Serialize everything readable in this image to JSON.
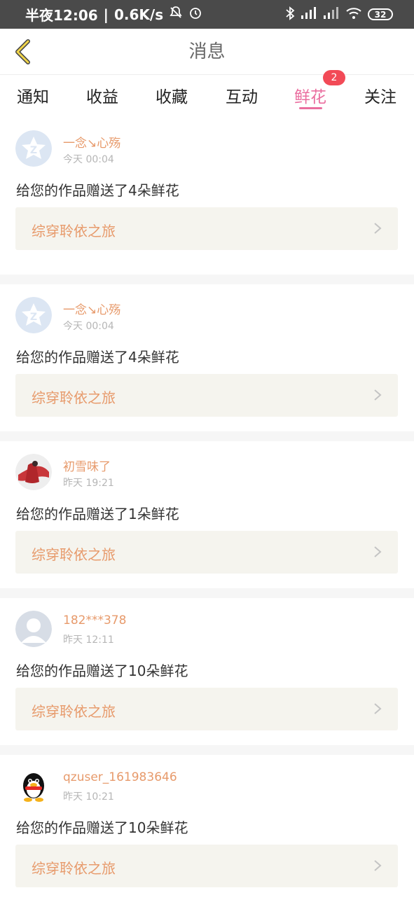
{
  "status_bar": {
    "time": "半夜12:06",
    "speed": "0.6K/s",
    "battery": "32"
  },
  "header": {
    "title": "消息"
  },
  "tabs": [
    {
      "label": "通知"
    },
    {
      "label": "收益"
    },
    {
      "label": "收藏"
    },
    {
      "label": "互动"
    },
    {
      "label": "鲜花",
      "active": true
    },
    {
      "label": "关注"
    }
  ],
  "badge_count": "2",
  "items": [
    {
      "name": "一念↘心殇",
      "time": "今天 00:04",
      "message": "给您的作品赠送了4朵鲜花",
      "book": "综穿聆依之旅",
      "avatar": "qzone-default-avatar"
    },
    {
      "name": "一念↘心殇",
      "time": "今天 00:04",
      "message": "给您的作品赠送了4朵鲜花",
      "book": "综穿聆依之旅",
      "avatar": "qzone-default-avatar"
    },
    {
      "name": "初雪味了",
      "time": "昨天 19:21",
      "message": "给您的作品赠送了1朵鲜花",
      "book": "综穿聆依之旅",
      "avatar": "red-dress-figure-avatar"
    },
    {
      "name": "182***378",
      "time": "昨天 12:11",
      "message": "给您的作品赠送了10朵鲜花",
      "book": "综穿聆依之旅",
      "avatar": "default-person-avatar"
    },
    {
      "name": "qzuser_161983646",
      "time": "昨天 10:21",
      "message": "给您的作品赠送了10朵鲜花",
      "book": "综穿聆依之旅",
      "avatar": "qq-penguin-avatar"
    }
  ],
  "colors": {
    "accent": "#ea6e9f",
    "name": "#e79a6b",
    "badge": "#f24a57",
    "card_bg": "#f5f4ee"
  }
}
